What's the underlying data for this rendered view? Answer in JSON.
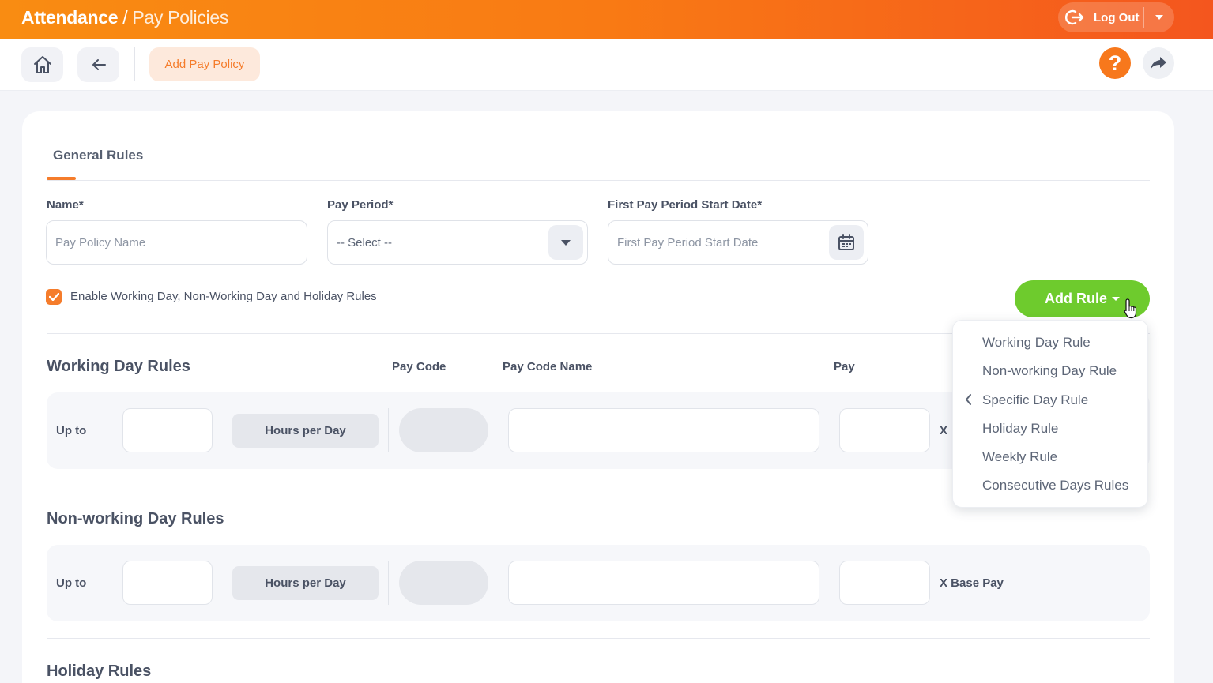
{
  "header": {
    "app": "Attendance",
    "separator": "/",
    "section": "Pay Policies",
    "logout_label": "Log Out"
  },
  "toolbar": {
    "active_action": "Add Pay Policy"
  },
  "tabs": {
    "active": "General Rules"
  },
  "form": {
    "name_label": "Name*",
    "name_placeholder": "Pay Policy Name",
    "period_label": "Pay Period*",
    "period_value": "-- Select --",
    "start_label": "First Pay Period Start Date*",
    "start_placeholder": "First Pay Period Start Date",
    "enable_rules_label": "Enable Working Day, Non-Working Day and Holiday Rules",
    "enable_rules_checked": true
  },
  "add_rule": {
    "label": "Add Rule",
    "menu": [
      "Working Day Rule",
      "Non-working Day Rule",
      "Specific Day Rule",
      "Holiday Rule",
      "Weekly Rule",
      "Consecutive Days Rules"
    ],
    "submenu_indicator_on": "Specific Day Rule"
  },
  "working_day": {
    "title": "Working Day Rules",
    "columns": {
      "pay_code": "Pay Code",
      "pay_code_name": "Pay Code Name",
      "pay": "Pay"
    },
    "row": {
      "up_to": "Up to",
      "hours": "Hours per Day",
      "x_label": "X"
    }
  },
  "non_working_day": {
    "title": "Non-working Day Rules",
    "row": {
      "up_to": "Up to",
      "hours": "Hours per Day",
      "x_label": "X Base Pay"
    }
  },
  "holiday": {
    "title": "Holiday Rules"
  },
  "colors": {
    "brand_orange": "#f7781c",
    "accent_green": "#6ecb2d"
  }
}
